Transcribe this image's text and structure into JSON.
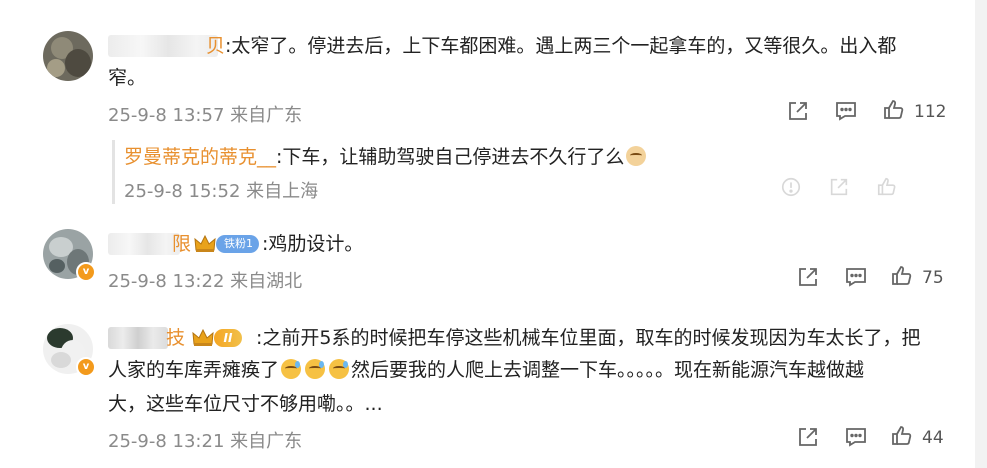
{
  "comments": [
    {
      "name_visible": "贝",
      "text": ":太窄了。停进去后，上下车都困难。遇上两三个一起拿车的，又等很久。出入都窄。",
      "text_line1": ":太窄了。停进去后，上下车都困难。遇上两三个一起拿车的，又等很久。出入都",
      "text_line2": "窄。",
      "timestamp": "25-9-8 13:57",
      "location": "来自广东",
      "likes": "112",
      "reply": {
        "name": "罗曼蒂克的蒂克__",
        "text": ":下车，让辅助驾驶自己停进去不久行了么",
        "timestamp": "25-9-8 15:52",
        "location": "来自上海"
      }
    },
    {
      "name_visible": "限",
      "fan_badge": "铁粉1",
      "text": ":鸡肋设计。",
      "timestamp": "25-9-8 13:22",
      "location": "来自湖北",
      "likes": "75"
    },
    {
      "name_visible": "技",
      "level_badge": "II",
      "text_line1": ":之前开5系的时候把车停这些机械车位里面，取车的时候发现因为车太长了，把",
      "text_line2a": "人家的车库弄瘫痪了",
      "text_line2b": "然后要我的人爬上去调整一下车。。。。。现在新能源汽车越做越",
      "text_line3": "大，这些车位尺寸不够用嘞。。...",
      "timestamp": "25-9-8 13:21",
      "location": "来自广东",
      "likes": "44"
    }
  ],
  "colors": {
    "username": "#e8902f",
    "meta": "#8a8a8a",
    "text": "#222222"
  }
}
